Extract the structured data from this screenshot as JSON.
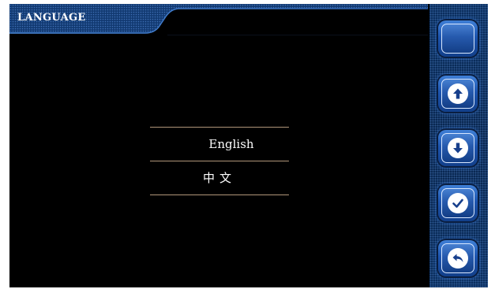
{
  "header": {
    "title": "LANGUAGE"
  },
  "languages": {
    "items": [
      {
        "label": "English"
      },
      {
        "label": "中文"
      }
    ]
  },
  "side_panel": {
    "buttons": [
      {
        "name": "blank-button",
        "icon": "none"
      },
      {
        "name": "up-button",
        "icon": "arrow-up-icon"
      },
      {
        "name": "down-button",
        "icon": "arrow-down-icon"
      },
      {
        "name": "confirm-button",
        "icon": "checkmark-icon"
      },
      {
        "name": "back-button",
        "icon": "return-arrow-icon"
      }
    ]
  },
  "colors": {
    "background": "#000000",
    "panel_blue": "#0a2a55",
    "button_blue": "#1d55b0",
    "divider": "#b0967a",
    "text": "#ffffff"
  }
}
